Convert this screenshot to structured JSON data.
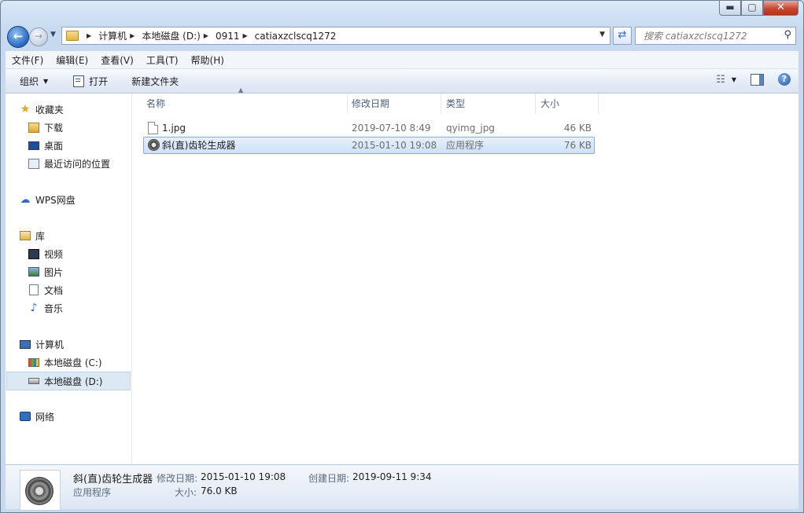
{
  "window": {
    "caption": {
      "minimize": "▬",
      "maximize": "▢",
      "close": "✕"
    }
  },
  "nav": {
    "back_glyph": "←",
    "forward_glyph": "→",
    "breadcrumb": [
      "计算机",
      "本地磁盘 (D:)",
      "0911",
      "catiaxzclscq1272"
    ],
    "search_placeholder": "搜索 catiaxzclscq1272"
  },
  "menu": [
    "文件(F)",
    "编辑(E)",
    "查看(V)",
    "工具(T)",
    "帮助(H)"
  ],
  "toolbar": {
    "organize": "组织",
    "open": "打开",
    "new_folder": "新建文件夹"
  },
  "sidebar": {
    "favorites": {
      "label": "收藏夹",
      "items": [
        "下载",
        "桌面",
        "最近访问的位置"
      ]
    },
    "wps": "WPS网盘",
    "libraries": {
      "label": "库",
      "items": [
        "视频",
        "图片",
        "文档",
        "音乐"
      ]
    },
    "computer": {
      "label": "计算机",
      "items": [
        "本地磁盘 (C:)",
        "本地磁盘 (D:)"
      ]
    },
    "network": "网络"
  },
  "columns": [
    "名称",
    "修改日期",
    "类型",
    "大小"
  ],
  "files": [
    {
      "name": "1.jpg",
      "date": "2019-07-10 8:49",
      "type": "qyimg_jpg",
      "size": "46 KB"
    },
    {
      "name": "斜(直)齿轮生成器",
      "date": "2015-01-10 19:08",
      "type": "应用程序",
      "size": "76 KB"
    }
  ],
  "details": {
    "name": "斜(直)齿轮生成器",
    "type": "应用程序",
    "modified_label": "修改日期:",
    "modified": "2015-01-10 19:08",
    "created_label": "创建日期:",
    "created": "2019-09-11 9:34",
    "size_label": "大小:",
    "size": "76.0 KB"
  },
  "icons": {
    "favorites": "star-icon",
    "download": "download-folder-icon",
    "desktop": "desktop-icon",
    "recent": "recent-places-icon",
    "wps": "cloud-icon",
    "library": "library-icon",
    "video": "video-icon",
    "picture": "picture-icon",
    "document": "document-icon",
    "music": "music-icon",
    "computer": "computer-icon",
    "drive_c": "windows-drive-icon",
    "drive_d": "drive-icon",
    "network": "network-icon"
  }
}
